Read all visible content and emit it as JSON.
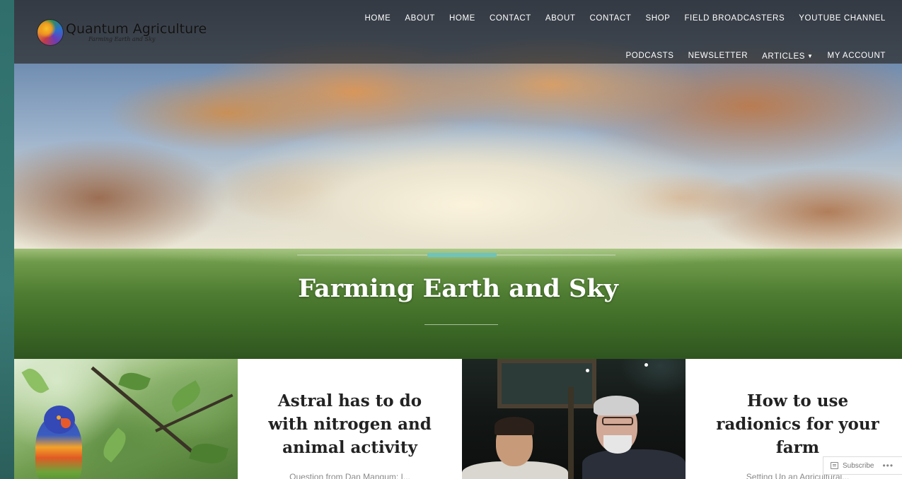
{
  "site": {
    "title": "Quantum Agriculture",
    "tagline": "Farming Earth and Sky"
  },
  "nav": {
    "row1": [
      "HOME",
      "ABOUT",
      "HOME",
      "CONTACT",
      "ABOUT",
      "CONTACT",
      "SHOP",
      "FIELD BROADCASTERS",
      "YOUTUBE CHANNEL"
    ],
    "row2": [
      "PODCASTS",
      "NEWSLETTER",
      "ARTICLES",
      "MY ACCOUNT"
    ]
  },
  "hero": {
    "title": "Farming Earth and Sky",
    "accent_color": "#6fc3b9"
  },
  "posts": [
    {
      "title": "Astral has to do with nitrogen and animal activity",
      "excerpt": "Question from Dan Mangum: I..."
    },
    {
      "title": "How to use radionics for your farm",
      "excerpt": "Setting Up an Agricultural..."
    }
  ],
  "subscribe": {
    "label": "Subscribe",
    "more": "•••"
  }
}
